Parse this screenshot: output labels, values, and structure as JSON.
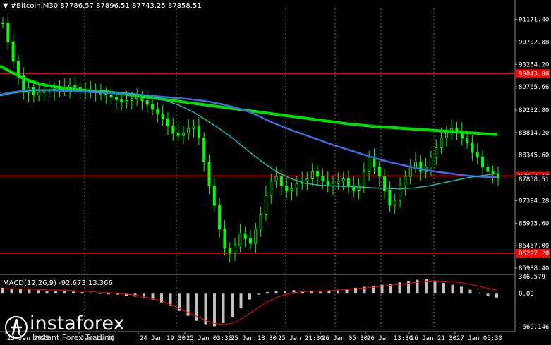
{
  "header": {
    "symbol_title": "#Bitcoin,M30",
    "ohlc": "87786.57 87896.51 87743.25 87858.51"
  },
  "macd": {
    "title": "MACD(12,26,9) -92.673 13.366"
  },
  "watermark": {
    "brand": "instaforex",
    "tagline": "Instant Forex Trading"
  },
  "colors": {
    "background": "#000000",
    "candles": "#00ff00",
    "ma_slow": "#00e000",
    "ma_mid": "#4169e1",
    "ma_fast": "#20b2aa",
    "levels": "#ff0000",
    "macd_hist": "#c0c0c0",
    "macd_signal": "#ff0000"
  },
  "chart_data": {
    "type": "line",
    "y_axis_ticks": [
      "91171.40",
      "90702.88",
      "90234.20",
      "89765.66",
      "89282.80",
      "88814.20",
      "88345.60",
      "87394.28",
      "86925.60",
      "86457.00",
      "85988.40"
    ],
    "x_axis_labels": [
      "23 Jan 2025",
      "23 Jan 11:30",
      "24 Jan 19:30",
      "25 Jan 03:30",
      "25 Jan 13:30",
      "25 Jan 21:30",
      "26 Jan 05:30",
      "26 Jan 13:30",
      "26 Jan 21:30",
      "27 Jan 05:30"
    ],
    "x_axis_labels_display": [
      "23 Jan 2025",
      "Jan 11:30",
      "24 Jan 19:30",
      "25 Jan 03:30",
      "25 Jan 13:30",
      "25 Jan 21:30",
      "26 Jan 05:30",
      "26 Jan 13:30",
      "26 Jan 21:30",
      "27 Jan 05:30"
    ],
    "ylim": [
      85900,
      91400
    ],
    "levels": [
      {
        "value": 90043.08,
        "label": "90043.08"
      },
      {
        "value": 87907.18,
        "label": "87907.18"
      },
      {
        "value": 86297.28,
        "label": "86297.28"
      }
    ],
    "current_price": {
      "value": 87858.51,
      "label": "87858.51"
    },
    "price": [
      91100,
      90700,
      90300,
      90000,
      89650,
      89750,
      89600,
      89650,
      89700,
      89680,
      89720,
      89740,
      89700,
      89800,
      89750,
      89700,
      89650,
      89680,
      89640,
      89620,
      89600,
      89550,
      89500,
      89450,
      89480,
      89520,
      89550,
      89480,
      89400,
      89300,
      89200,
      89100,
      88950,
      88800,
      88750,
      88800,
      88900,
      88950,
      88700,
      88200,
      87700,
      87300,
      86800,
      86400,
      86300,
      86450,
      86700,
      86600,
      86500,
      86800,
      87100,
      87500,
      87800,
      87900,
      87700,
      87600,
      87650,
      87750,
      87800,
      87850,
      88000,
      87900,
      87800,
      87700,
      87750,
      87800,
      87850,
      87700,
      87600,
      87700,
      88000,
      88300,
      88100,
      87900,
      87600,
      87300,
      87400,
      87700,
      87900,
      88100,
      88200,
      88000,
      88100,
      88300,
      88500,
      88700,
      88800,
      88900,
      88850,
      88700,
      88600,
      88400,
      88300,
      88100,
      88000,
      87950,
      87858
    ],
    "series": [
      {
        "name": "MA slow",
        "values": [
          90200,
          90120,
          90040,
          89960,
          89900,
          89850,
          89810,
          89780,
          89760,
          89740,
          89720,
          89700,
          89690,
          89680,
          89670,
          89660,
          89640,
          89620,
          89600,
          89580,
          89560,
          89540,
          89520,
          89500,
          89480,
          89460,
          89440,
          89420,
          89400,
          89380,
          89360,
          89340,
          89320,
          89300,
          89280,
          89260,
          89240,
          89220,
          89200,
          89180,
          89160,
          89140,
          89120,
          89100,
          89080,
          89060,
          89040,
          89020,
          89000,
          88985,
          88970,
          88955,
          88940,
          88930,
          88920,
          88910,
          88900,
          88890,
          88880,
          88870,
          88860,
          88850,
          88840,
          88830,
          88820,
          88810,
          88800,
          88790,
          88780,
          88770
        ]
      },
      {
        "name": "MA mid",
        "values": [
          89600,
          89650,
          89680,
          89700,
          89700,
          89690,
          89680,
          89670,
          89660,
          89650,
          89640,
          89630,
          89620,
          89600,
          89580,
          89560,
          89540,
          89520,
          89500,
          89470,
          89430,
          89380,
          89320,
          89250,
          89150,
          89040,
          88950,
          88860,
          88780,
          88700,
          88620,
          88540,
          88470,
          88400,
          88330,
          88260,
          88200,
          88150,
          88100,
          88050,
          88010,
          87980,
          87950,
          87920,
          87900,
          87890,
          87880
        ]
      },
      {
        "name": "MA fast",
        "values": [
          89580,
          89640,
          89680,
          89700,
          89710,
          89700,
          89690,
          89680,
          89660,
          89640,
          89610,
          89560,
          89480,
          89380,
          89240,
          89060,
          88870,
          88660,
          88420,
          88200,
          88000,
          87860,
          87760,
          87720,
          87700,
          87690,
          87680,
          87660,
          87650,
          87640,
          87660,
          87700,
          87760,
          87820,
          87880,
          87920,
          87960
        ]
      }
    ],
    "macd_axis_ticks": [
      "346.579",
      "0.00",
      "-669.146"
    ],
    "macd_ylim": [
      -669.146,
      346.579
    ],
    "macd_hist": [
      120,
      100,
      90,
      80,
      70,
      60,
      60,
      50,
      40,
      30,
      20,
      10,
      0,
      -20,
      -40,
      -60,
      -80,
      -120,
      -180,
      -250,
      -350,
      -450,
      -550,
      -620,
      -660,
      -600,
      -480,
      -300,
      -120,
      -20,
      30,
      50,
      60,
      70,
      60,
      50,
      40,
      60,
      80,
      100,
      120,
      140,
      160,
      180,
      200,
      230,
      260,
      280,
      290,
      260,
      220,
      180,
      140,
      80,
      20,
      -40,
      -80
    ],
    "macd_signal": [
      100,
      100,
      95,
      90,
      85,
      80,
      75,
      70,
      60,
      50,
      40,
      30,
      20,
      5,
      -10,
      -30,
      -60,
      -100,
      -150,
      -220,
      -300,
      -380,
      -460,
      -540,
      -600,
      -630,
      -600,
      -520,
      -400,
      -280,
      -170,
      -80,
      -20,
      20,
      40,
      50,
      55,
      60,
      70,
      85,
      100,
      115,
      130,
      150,
      170,
      190,
      210,
      230,
      250,
      260,
      255,
      240,
      220,
      190,
      150,
      110,
      70
    ]
  }
}
